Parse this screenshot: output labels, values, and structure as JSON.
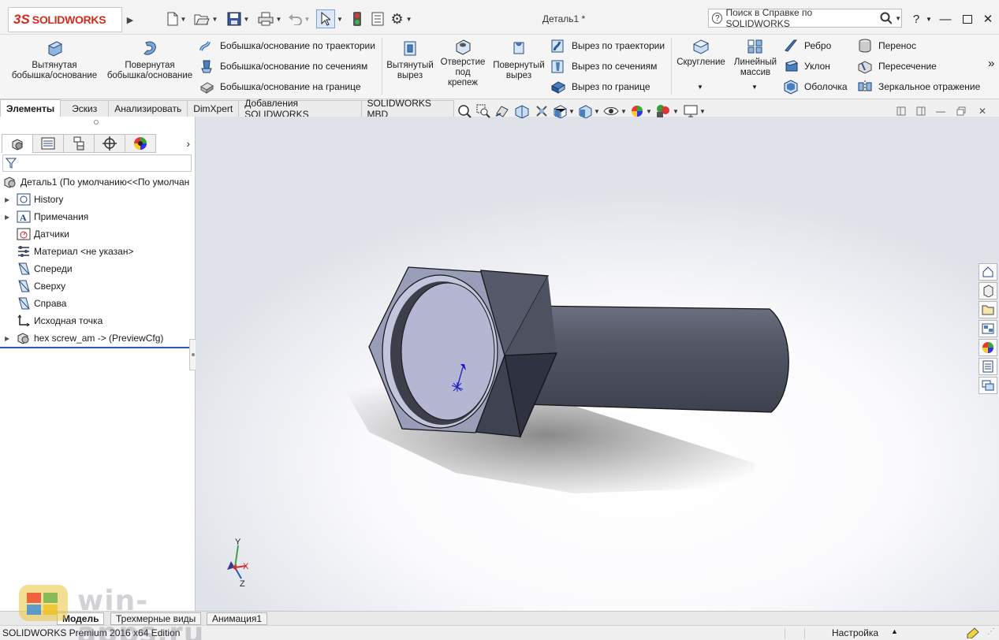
{
  "app": {
    "logo_prefix": "3S",
    "logo_text": "SOLIDWORKS",
    "document_title": "Деталь1 *"
  },
  "help": {
    "search_placeholder": "Поиск в Справке по SOLIDWORKS"
  },
  "ribbon": {
    "extruded_boss": {
      "line1": "Вытянутая",
      "line2": "бобышка/основание"
    },
    "revolved_boss": {
      "line1": "Повернутая",
      "line2": "бобышка/основание"
    },
    "swept_boss": "Бобышка/основание по траектории",
    "lofted_boss": "Бобышка/основание по сечениям",
    "boundary_boss": "Бобышка/основание на границе",
    "extruded_cut": {
      "line1": "Вытянутый",
      "line2": "вырез"
    },
    "hole_wizard": {
      "line1": "Отверстие",
      "line2": "под",
      "line3": "крепеж"
    },
    "revolved_cut": {
      "line1": "Повернутый",
      "line2": "вырез"
    },
    "swept_cut": "Вырез по траектории",
    "lofted_cut": "Вырез по сечениям",
    "boundary_cut": "Вырез по границе",
    "fillet": "Скругление",
    "linear_pattern": {
      "line1": "Линейный",
      "line2": "массив"
    },
    "rib": "Ребро",
    "draft": "Уклон",
    "shell": "Оболочка",
    "wrap": "Перенос",
    "intersect": "Пересечение",
    "mirror": "Зеркальное отражение",
    "more": "»"
  },
  "tabs": [
    "Элементы",
    "Эскиз",
    "Анализировать",
    "DimXpert",
    "Добавления SOLIDWORKS",
    "SOLIDWORKS MBD"
  ],
  "tree": {
    "root": "Деталь1  (По умолчанию<<По умолчан",
    "items": [
      {
        "label": "History"
      },
      {
        "label": "Примечания"
      },
      {
        "label": "Датчики"
      },
      {
        "label": "Материал <не указан>"
      },
      {
        "label": "Спереди"
      },
      {
        "label": "Сверху"
      },
      {
        "label": "Справа"
      },
      {
        "label": "Исходная точка"
      },
      {
        "label": "hex screw_am -> (PreviewCfg)"
      }
    ]
  },
  "triad": {
    "x": "X",
    "y": "Y",
    "z": "Z"
  },
  "bottom_tabs": [
    "Модель",
    "Трехмерные виды",
    "Анимация1"
  ],
  "status": {
    "edition": "SOLIDWORKS Premium 2016 x64 Edition",
    "settings": "Настройка"
  },
  "watermark": "win-apps.ru",
  "colors": {
    "logo_red": "#d42a1e",
    "bolt_body": "#4d5160",
    "bolt_face": "#b4b6d2"
  }
}
